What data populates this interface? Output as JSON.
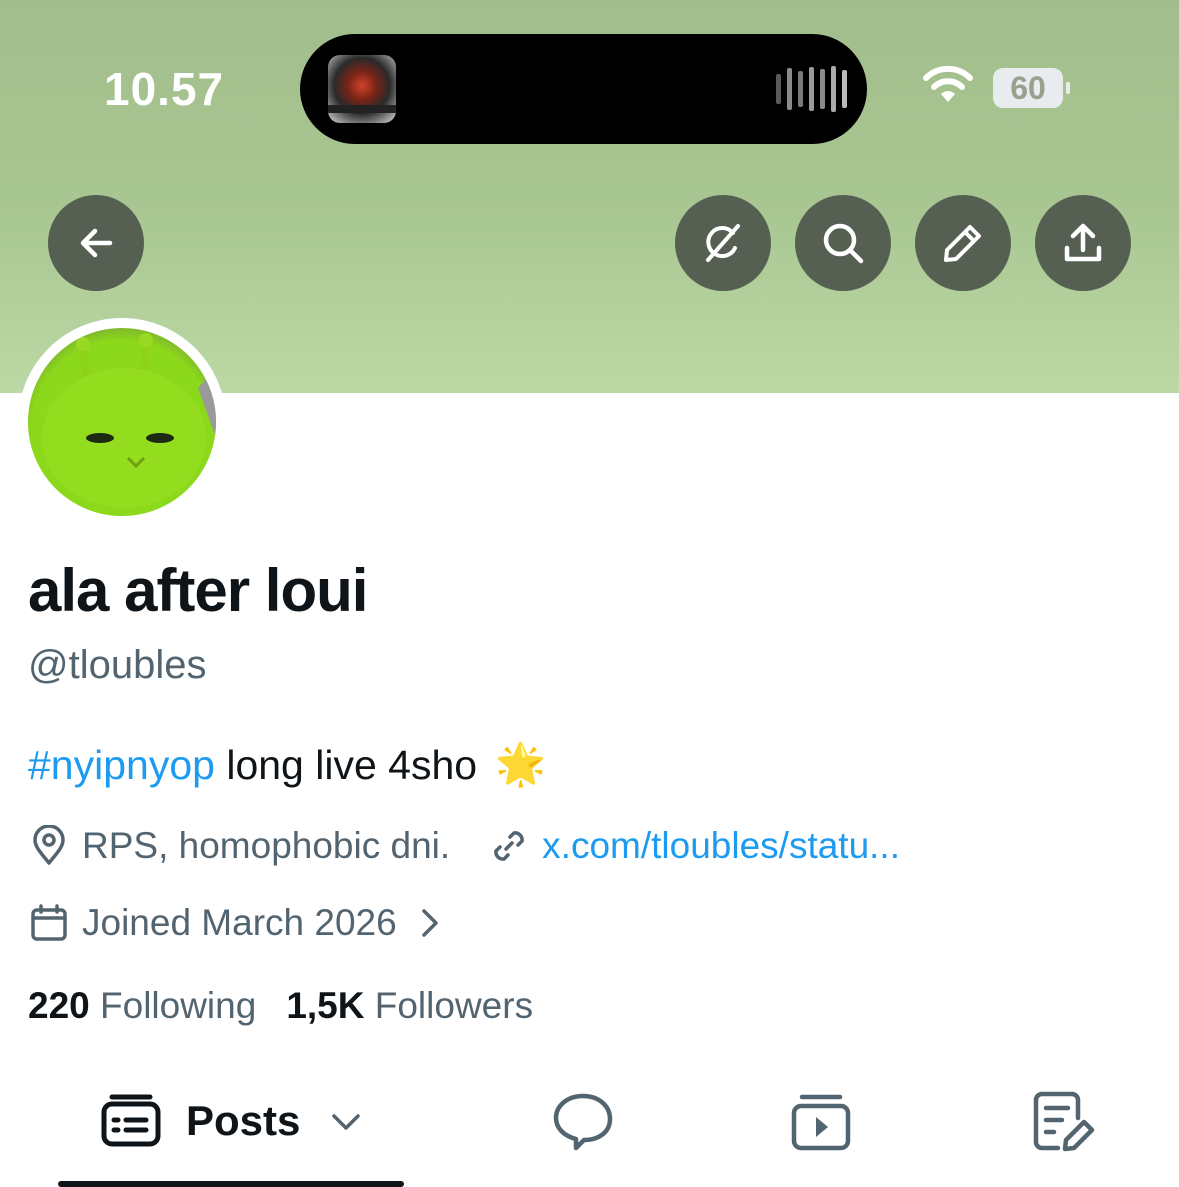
{
  "status_bar": {
    "time": "10.57",
    "battery": "60"
  },
  "profile": {
    "display_name": "ala after loui",
    "handle": "@tloubles",
    "bio_hashtag": "#nyipnyop",
    "bio_text": " long live 4sho",
    "bio_emoji": "🌟",
    "location": "RPS, homophobic dni.",
    "link": "x.com/tloubles/statu...",
    "joined": "Joined March 2026",
    "following_count": "220",
    "following_label": "Following",
    "followers_count": "1,5K",
    "followers_label": "Followers"
  },
  "tabs": {
    "posts_label": "Posts"
  },
  "colors": {
    "accent": "#1d9bf0",
    "secondary_text": "#536471",
    "banner": "#a9c792",
    "header_button": "#566052"
  },
  "icons": {
    "back": "arrow-left-icon",
    "grok": "grok-icon",
    "search": "search-icon",
    "edit": "pencil-icon",
    "share": "share-icon",
    "location": "location-pin-icon",
    "link": "link-icon",
    "calendar": "calendar-icon"
  }
}
